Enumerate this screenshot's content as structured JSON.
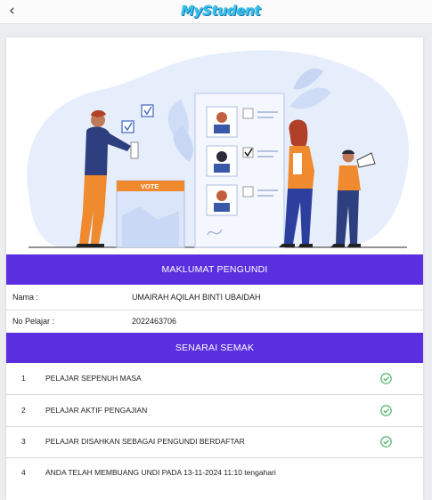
{
  "header": {
    "logo_text": "MyStudent",
    "back_icon": "chevron-left-icon"
  },
  "illustration": {
    "ballot_box_label": "VOTE"
  },
  "voter_info": {
    "title": "MAKLUMAT PENGUNDI",
    "fields": [
      {
        "label": "Nama :",
        "value": "UMAIRAH AQILAH BINTI UBAIDAH"
      },
      {
        "label": "No Pelajar :",
        "value": "2022463706"
      }
    ]
  },
  "checklist": {
    "title": "SENARAI SEMAK",
    "items": [
      {
        "number": "1",
        "text": "PELAJAR SEPENUH MASA",
        "status_icon": "check-circle-icon"
      },
      {
        "number": "2",
        "text": "PELAJAR AKTIF PENGAJIAN",
        "status_icon": "check-circle-icon"
      },
      {
        "number": "3",
        "text": "PELAJAR DISAHKAN SEBAGAI PENGUNDI BERDAFTAR",
        "status_icon": "check-circle-icon"
      },
      {
        "number": "4",
        "text": "ANDA TELAH MEMBUANG UNDI PADA 13-11-2024 11:10 tengahari"
      }
    ]
  },
  "colors": {
    "accent": "#5b2ee0",
    "check": "#3fae5a",
    "logo": "#36c4ee"
  }
}
